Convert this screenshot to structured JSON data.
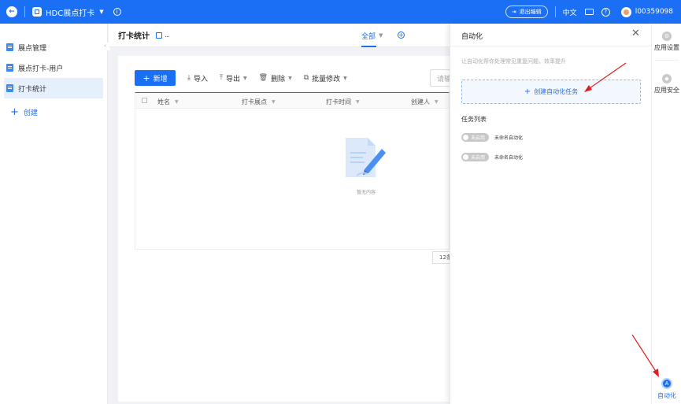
{
  "topbar": {
    "app_name": "HDC展点打卡",
    "exit_edit": "退出编辑",
    "language": "中文",
    "username": "l00359098"
  },
  "sidebar": {
    "items": [
      {
        "label": "展点管理"
      },
      {
        "label": "展点打卡-用户"
      },
      {
        "label": "打卡统计"
      }
    ],
    "create_label": "创建"
  },
  "main": {
    "title": "打卡统计",
    "more": "...",
    "tab_all": "全部",
    "toolbar": {
      "new": "新增",
      "import": "导入",
      "export": "导出",
      "delete": "删除",
      "batch_edit": "批量修改"
    },
    "search_placeholder": "请输",
    "columns": [
      "姓名",
      "打卡展点",
      "打卡时间",
      "创建人"
    ],
    "empty_text": "暂无内容",
    "page_size": "12条"
  },
  "automation_panel": {
    "title": "自动化",
    "description": "让自动化帮你处理常见重复问题，效率提升",
    "create_task": "创建自动化任务",
    "task_list_title": "任务列表",
    "tasks": [
      {
        "status": "未启用",
        "name": "未命名自动化"
      },
      {
        "status": "未启用",
        "name": "未命名自动化"
      }
    ]
  },
  "rail": {
    "app_settings": "应用设置",
    "app_security": "应用安全",
    "automation": "自动化"
  },
  "colors": {
    "primary": "#1b6ff5",
    "annotation_arrow": "#e02020"
  }
}
